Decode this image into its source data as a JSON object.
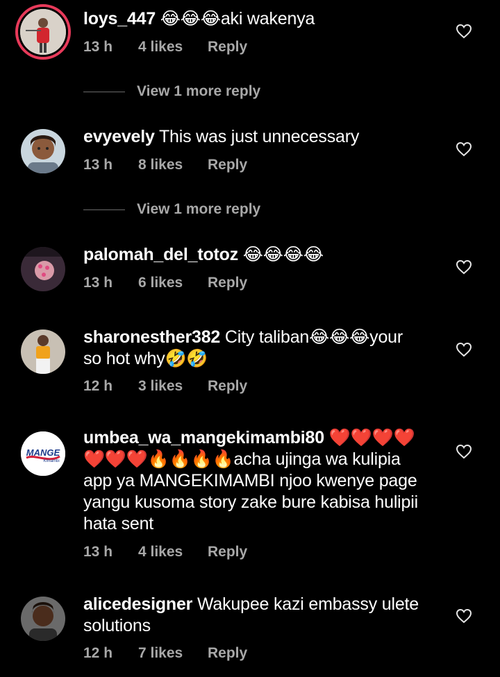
{
  "comments": [
    {
      "username": "loys_447",
      "text": "😂😂😂aki wakenya",
      "time": "13 h",
      "likes": "4 likes",
      "reply": "Reply",
      "more_replies": "View 1 more reply"
    },
    {
      "username": "evyevely",
      "text": "This was just unnecessary",
      "time": "13 h",
      "likes": "8 likes",
      "reply": "Reply",
      "more_replies": "View 1 more reply"
    },
    {
      "username": "palomah_del_totoz",
      "text": "😂😂😂😂",
      "time": "13 h",
      "likes": "6 likes",
      "reply": "Reply"
    },
    {
      "username": "sharonesther382",
      "text_line1": "City taliban😂😂😂your",
      "text_line2": "so hot why🤣🤣",
      "time": "12 h",
      "likes": "3 likes",
      "reply": "Reply"
    },
    {
      "username": "umbea_wa_mangekimambi80",
      "text_line1": "❤️❤️❤️❤️",
      "text_line2": "❤️❤️❤️🔥🔥🔥🔥acha ujinga wa kulipia",
      "text_line3": "app ya MANGEKIMAMBI njoo kwenye page",
      "text_line4": "yangu kusoma story zake bure kabisa hulipii",
      "text_line5": "hata sent",
      "time": "13 h",
      "likes": "4 likes",
      "reply": "Reply",
      "avatar_logo_main": "MANGE",
      "avatar_logo_sub": "Kimambi"
    },
    {
      "username": "alicedesigner",
      "text_line1": "Wakupee kazi embassy ulete",
      "text_line2": "solutions",
      "time": "12 h",
      "likes": "7 likes",
      "reply": "Reply"
    }
  ],
  "colors": {
    "background": "#000000",
    "text": "#ffffff",
    "meta": "#a8a8a8",
    "story_ring": "#e83a5a"
  }
}
